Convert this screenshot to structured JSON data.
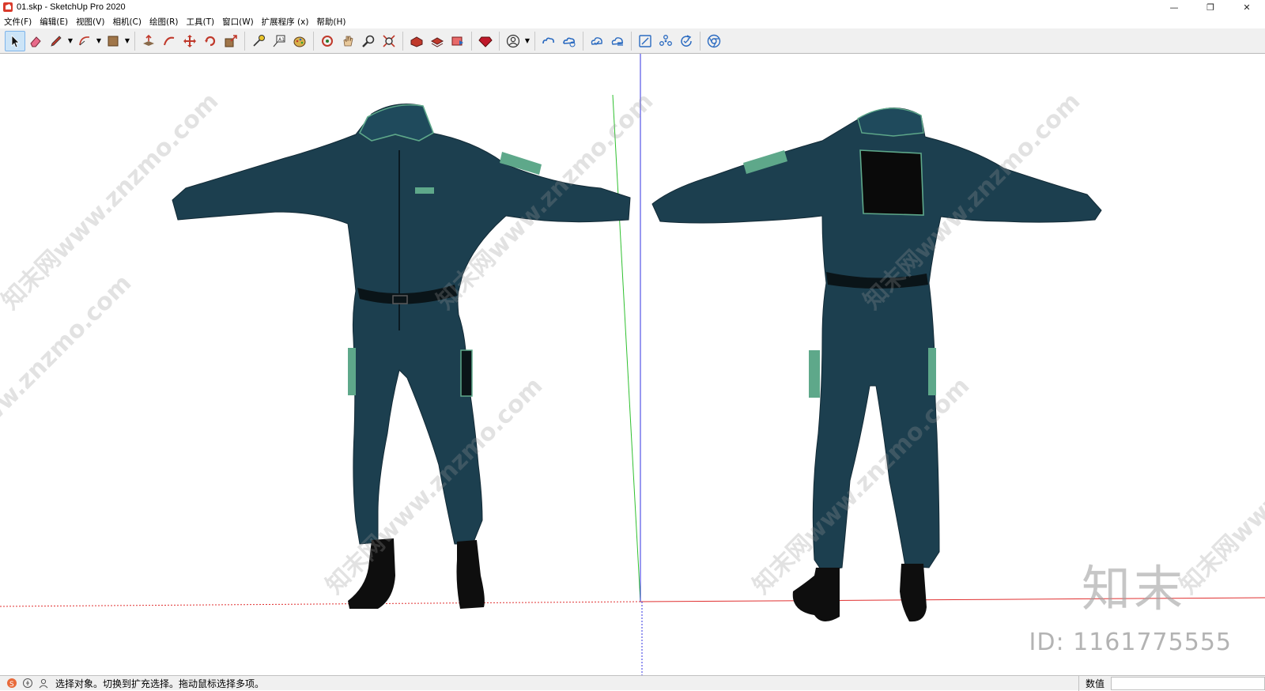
{
  "window": {
    "title": "01.skp - SketchUp Pro 2020",
    "minimize": "—",
    "restore": "❐",
    "close": "✕"
  },
  "menu": [
    {
      "label": "文件(F)"
    },
    {
      "label": "编辑(E)"
    },
    {
      "label": "视图(V)"
    },
    {
      "label": "相机(C)"
    },
    {
      "label": "绘图(R)"
    },
    {
      "label": "工具(T)"
    },
    {
      "label": "窗口(W)"
    },
    {
      "label": "扩展程序 (x)"
    },
    {
      "label": "帮助(H)"
    }
  ],
  "toolbar": {
    "icons": [
      "select-icon",
      "eraser-icon",
      "pencil-icon",
      "arc-icon",
      "paint-bucket-icon",
      "push-pull-icon",
      "follow-me-icon",
      "move-icon",
      "rotate-icon",
      "scale-icon",
      "tape-measure-icon",
      "text-icon",
      "paint-icon",
      "orbit-icon",
      "pan-icon",
      "zoom-icon",
      "zoom-extents-icon",
      "warehouse-icon",
      "extension-warehouse-icon",
      "layout-icon",
      "ruby-icon",
      "account-icon",
      "trimble-connect-icon",
      "trimble-share-icon",
      "cloud-sync-icon",
      "cloud-list-icon",
      "add-location-icon",
      "components-icon",
      "refresh-icon",
      "chrome-icon"
    ],
    "accent": "#cce4f7"
  },
  "viewport": {
    "watermark_text": "知末网www.znzmo.com",
    "brand_logo": "知末",
    "brand_id": "ID: 1161775555",
    "axis_colors": {
      "red": "#e03030",
      "green": "#2fc02f",
      "blue": "#3030e0"
    },
    "suit_color": "#1c3f4f",
    "accent_color": "#5ea88a"
  },
  "status": {
    "text": "选择对象。切换到扩充选择。拖动鼠标选择多项。",
    "measure_label": "数值"
  }
}
